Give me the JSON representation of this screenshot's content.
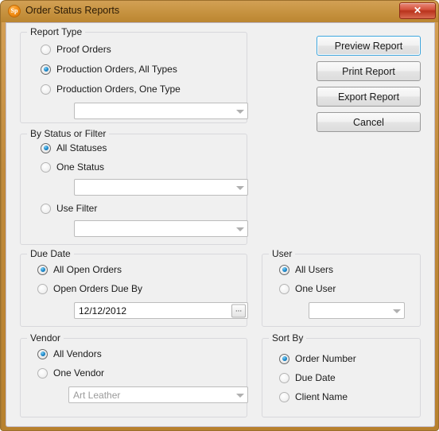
{
  "window": {
    "title": "Order Status Reports",
    "app_icon_text": "Sp",
    "app_icon_name": "spectra-app-icon",
    "close_label": "✕",
    "accent_titlebar": "#c6923f",
    "accent_close": "#b9331c",
    "accent_focus": "#3ca5dd",
    "client_background": "#f0f0f0"
  },
  "groups": {
    "report_type": {
      "legend": "Report Type",
      "options": [
        {
          "label": "Proof Orders",
          "checked": false
        },
        {
          "label": "Production Orders, All Types",
          "checked": true
        },
        {
          "label": "Production Orders, One Type",
          "checked": false
        }
      ],
      "combo": {
        "value": "",
        "placeholder": ""
      }
    },
    "by_status_or_filter": {
      "legend": "By Status or Filter",
      "options": [
        {
          "label": "All Statuses",
          "checked": true
        },
        {
          "label": "One Status",
          "checked": false
        },
        {
          "label": "Use Filter",
          "checked": false
        }
      ],
      "status_combo": {
        "value": "",
        "placeholder": ""
      },
      "filter_combo": {
        "value": "",
        "placeholder": ""
      }
    },
    "due_date": {
      "legend": "Due Date",
      "options": [
        {
          "label": "All Open Orders",
          "checked": true
        },
        {
          "label": "Open Orders Due By",
          "checked": false
        }
      ],
      "date_field": {
        "value": "12/12/2012",
        "browse_label": "..."
      }
    },
    "vendor": {
      "legend": "Vendor",
      "options": [
        {
          "label": "All Vendors",
          "checked": true
        },
        {
          "label": "One Vendor",
          "checked": false
        }
      ],
      "combo": {
        "value": "Art Leather"
      }
    },
    "user": {
      "legend": "User",
      "options": [
        {
          "label": "All Users",
          "checked": true
        },
        {
          "label": "One User",
          "checked": false
        }
      ],
      "combo": {
        "value": ""
      }
    },
    "sort_by": {
      "legend": "Sort By",
      "options": [
        {
          "label": "Order Number",
          "checked": true
        },
        {
          "label": "Due Date",
          "checked": false
        },
        {
          "label": "Client Name",
          "checked": false
        }
      ]
    }
  },
  "buttons": {
    "preview": "Preview Report",
    "print": "Print Report",
    "export": "Export Report",
    "cancel": "Cancel"
  }
}
